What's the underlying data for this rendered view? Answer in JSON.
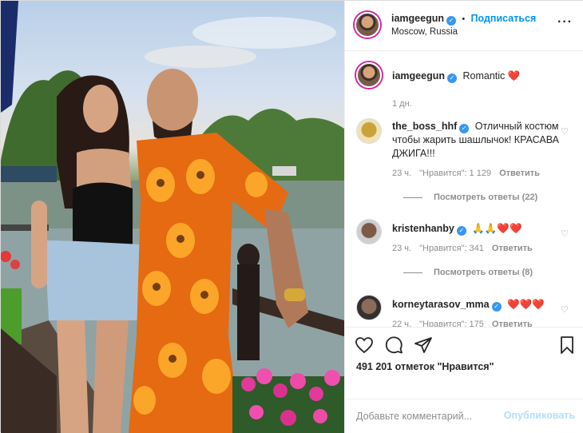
{
  "post": {
    "author": "iamgeegun",
    "follow_label": "Подписаться",
    "dot": "•",
    "location": "Moscow, Russia",
    "more_icon": "more-horizontal-icon"
  },
  "caption": {
    "username": "iamgeegun",
    "text": "Romantic",
    "emoji": "❤️",
    "time": "1 дн."
  },
  "comments": [
    {
      "username": "the_boss_hhf",
      "verified": true,
      "text": "Отличный костюм чтобы жарить шашлычок! КРАСАВА ДЖИГА!!!",
      "time": "23 ч.",
      "likes": "\"Нравится\": 1 129",
      "reply": "Ответить",
      "replies": "Посмотреть ответы (22)"
    },
    {
      "username": "kristenhanby",
      "verified": true,
      "text": "🙏🙏❤️❤️",
      "time": "23 ч.",
      "likes": "\"Нравится\": 341",
      "reply": "Ответить",
      "replies": "Посмотреть ответы (8)"
    },
    {
      "username": "korneytarasov_mma",
      "verified": true,
      "text": "❤️❤️❤️",
      "time": "22 ч.",
      "likes": "\"Нравится\": 175",
      "reply": "Ответить"
    }
  ],
  "actions": {
    "like_icon": "heart-icon",
    "comment_icon": "comment-icon",
    "share_icon": "send-icon",
    "save_icon": "bookmark-icon"
  },
  "likes_text": "491 201 отметок \"Нравится\"",
  "comment_box": {
    "placeholder": "Добавьте комментарий...",
    "publish": "Опубликовать"
  },
  "colors": {
    "accent": "#0095f6",
    "verified": "#3897f0",
    "muted": "#8e8e8e",
    "publish_disabled": "#b2dffc"
  }
}
